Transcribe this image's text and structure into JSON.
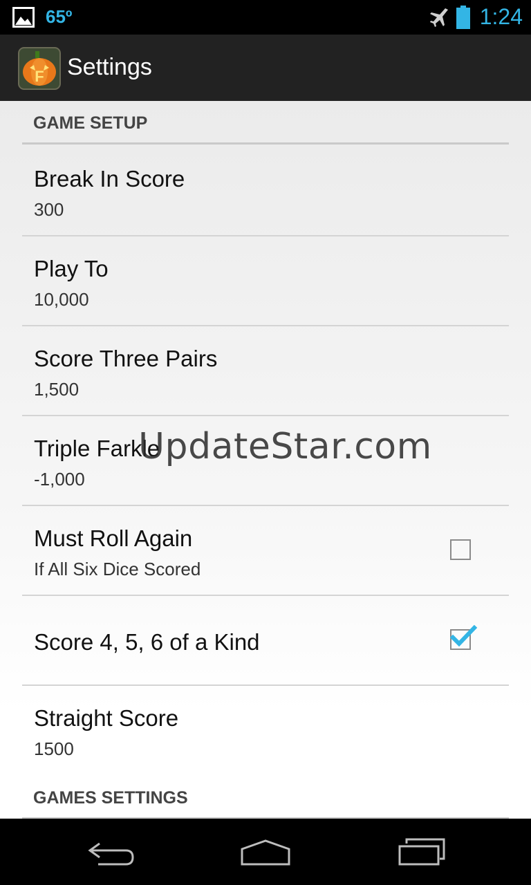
{
  "status_bar": {
    "temperature": "65º",
    "time": "1:24",
    "icons": [
      "photo-icon",
      "airplane-mode-icon",
      "battery-icon"
    ]
  },
  "action_bar": {
    "title": "Settings",
    "app_icon": "farkle-pumpkin-app-icon"
  },
  "sections": [
    {
      "header": "GAME SETUP",
      "items": [
        {
          "title": "Break In Score",
          "summary": "300"
        },
        {
          "title": "Play To",
          "summary": "10,000"
        },
        {
          "title": "Score Three Pairs",
          "summary": "1,500"
        },
        {
          "title": "Triple Farkle",
          "summary": "-1,000"
        },
        {
          "title": "Must Roll Again",
          "summary": "If All Six Dice Scored",
          "checkbox": "unchecked"
        },
        {
          "title": "Score 4, 5, 6 of a Kind",
          "checkbox": "checked"
        },
        {
          "title": "Straight Score",
          "summary": "1500"
        }
      ]
    },
    {
      "header": "GAMES SETTINGS",
      "items": []
    }
  ],
  "watermark": "UpdateStar.com",
  "nav_bar": {
    "icons": [
      "back-icon",
      "home-icon",
      "recent-apps-icon"
    ]
  },
  "colors": {
    "accent": "#33b5e5",
    "action_bar": "#222222",
    "status_bar": "#000000"
  }
}
